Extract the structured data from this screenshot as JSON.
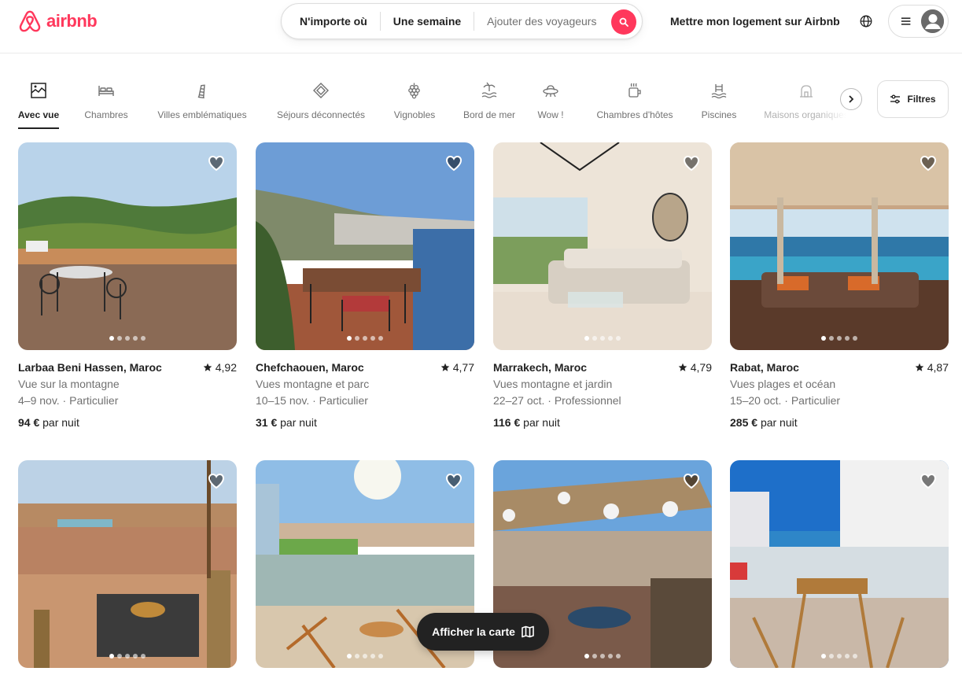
{
  "brand": {
    "name": "airbnb",
    "color": "#FF385C"
  },
  "search": {
    "anywhere": "N'importe où",
    "week": "Une semaine",
    "guests": "Ajouter des voyageurs",
    "button_icon": "search-icon"
  },
  "header": {
    "host_link": "Mettre mon logement sur Airbnb",
    "globe_icon": "globe-icon",
    "menu_icon": "hamburger-icon",
    "avatar_icon": "user-avatar-icon"
  },
  "categories": [
    {
      "label": "Avec vue",
      "icon": "view-icon",
      "active": true
    },
    {
      "label": "Chambres",
      "icon": "bed-icon"
    },
    {
      "label": "Villes emblématiques",
      "icon": "landmark-tower-icon"
    },
    {
      "label": "Séjours déconnectés",
      "icon": "off-grid-icon"
    },
    {
      "label": "Vignobles",
      "icon": "grapes-icon"
    },
    {
      "label": "Bord de mer",
      "icon": "beachfront-icon"
    },
    {
      "label": "Wow !",
      "icon": "ufo-icon"
    },
    {
      "label": "Chambres d'hôtes",
      "icon": "bed-and-breakfast-icon"
    },
    {
      "label": "Piscines",
      "icon": "pool-icon"
    },
    {
      "label": "Maisons organiques",
      "icon": "organic-house-icon"
    }
  ],
  "filters": {
    "label": "Filtres",
    "icon": "sliders-icon"
  },
  "listings": [
    {
      "place": "Larbaa Beni Hassen, Maroc",
      "rating": "4,92",
      "line1": "Vue sur la montagne",
      "line2": "4–9 nov. · Particulier",
      "price": "94 €",
      "price_suffix": "par nuit"
    },
    {
      "place": "Chefchaouen, Maroc",
      "rating": "4,77",
      "line1": "Vues montagne et parc",
      "line2": "10–15 nov. · Particulier",
      "price": "31 €",
      "price_suffix": "par nuit"
    },
    {
      "place": "Marrakech, Maroc",
      "rating": "4,79",
      "line1": "Vues montagne et jardin",
      "line2": "22–27 oct. · Professionnel",
      "price": "116 €",
      "price_suffix": "par nuit"
    },
    {
      "place": "Rabat, Maroc",
      "rating": "4,87",
      "line1": "Vues plages et océan",
      "line2": "15–20 oct. · Particulier",
      "price": "285 €",
      "price_suffix": "par nuit"
    },
    {
      "place": "",
      "rating": "",
      "line1": "",
      "line2": "",
      "price": "",
      "price_suffix": ""
    },
    {
      "place": "",
      "rating": "",
      "line1": "",
      "line2": "",
      "price": "",
      "price_suffix": ""
    },
    {
      "place": "",
      "rating": "",
      "line1": "",
      "line2": "",
      "price": "",
      "price_suffix": ""
    },
    {
      "place": "",
      "rating": "",
      "line1": "",
      "line2": "",
      "price": "",
      "price_suffix": ""
    }
  ],
  "map_button": {
    "label": "Afficher la carte",
    "icon": "map-icon"
  }
}
